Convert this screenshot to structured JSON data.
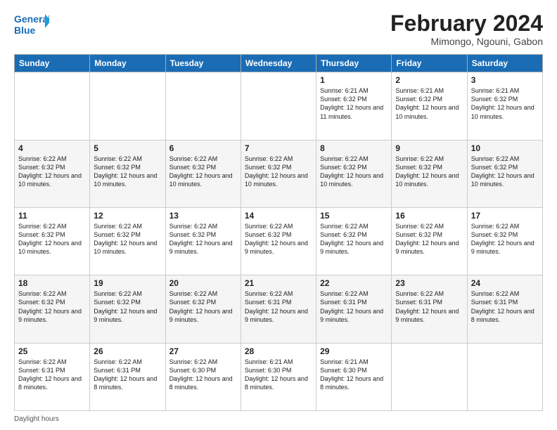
{
  "logo": {
    "line1": "General",
    "line2": "Blue"
  },
  "title": "February 2024",
  "subtitle": "Mimongo, Ngouni, Gabon",
  "days": [
    "Sunday",
    "Monday",
    "Tuesday",
    "Wednesday",
    "Thursday",
    "Friday",
    "Saturday"
  ],
  "weeks": [
    [
      {
        "num": "",
        "info": ""
      },
      {
        "num": "",
        "info": ""
      },
      {
        "num": "",
        "info": ""
      },
      {
        "num": "",
        "info": ""
      },
      {
        "num": "1",
        "info": "Sunrise: 6:21 AM\nSunset: 6:32 PM\nDaylight: 12 hours and 11 minutes."
      },
      {
        "num": "2",
        "info": "Sunrise: 6:21 AM\nSunset: 6:32 PM\nDaylight: 12 hours and 10 minutes."
      },
      {
        "num": "3",
        "info": "Sunrise: 6:21 AM\nSunset: 6:32 PM\nDaylight: 12 hours and 10 minutes."
      }
    ],
    [
      {
        "num": "4",
        "info": "Sunrise: 6:22 AM\nSunset: 6:32 PM\nDaylight: 12 hours and 10 minutes."
      },
      {
        "num": "5",
        "info": "Sunrise: 6:22 AM\nSunset: 6:32 PM\nDaylight: 12 hours and 10 minutes."
      },
      {
        "num": "6",
        "info": "Sunrise: 6:22 AM\nSunset: 6:32 PM\nDaylight: 12 hours and 10 minutes."
      },
      {
        "num": "7",
        "info": "Sunrise: 6:22 AM\nSunset: 6:32 PM\nDaylight: 12 hours and 10 minutes."
      },
      {
        "num": "8",
        "info": "Sunrise: 6:22 AM\nSunset: 6:32 PM\nDaylight: 12 hours and 10 minutes."
      },
      {
        "num": "9",
        "info": "Sunrise: 6:22 AM\nSunset: 6:32 PM\nDaylight: 12 hours and 10 minutes."
      },
      {
        "num": "10",
        "info": "Sunrise: 6:22 AM\nSunset: 6:32 PM\nDaylight: 12 hours and 10 minutes."
      }
    ],
    [
      {
        "num": "11",
        "info": "Sunrise: 6:22 AM\nSunset: 6:32 PM\nDaylight: 12 hours and 10 minutes."
      },
      {
        "num": "12",
        "info": "Sunrise: 6:22 AM\nSunset: 6:32 PM\nDaylight: 12 hours and 10 minutes."
      },
      {
        "num": "13",
        "info": "Sunrise: 6:22 AM\nSunset: 6:32 PM\nDaylight: 12 hours and 9 minutes."
      },
      {
        "num": "14",
        "info": "Sunrise: 6:22 AM\nSunset: 6:32 PM\nDaylight: 12 hours and 9 minutes."
      },
      {
        "num": "15",
        "info": "Sunrise: 6:22 AM\nSunset: 6:32 PM\nDaylight: 12 hours and 9 minutes."
      },
      {
        "num": "16",
        "info": "Sunrise: 6:22 AM\nSunset: 6:32 PM\nDaylight: 12 hours and 9 minutes."
      },
      {
        "num": "17",
        "info": "Sunrise: 6:22 AM\nSunset: 6:32 PM\nDaylight: 12 hours and 9 minutes."
      }
    ],
    [
      {
        "num": "18",
        "info": "Sunrise: 6:22 AM\nSunset: 6:32 PM\nDaylight: 12 hours and 9 minutes."
      },
      {
        "num": "19",
        "info": "Sunrise: 6:22 AM\nSunset: 6:32 PM\nDaylight: 12 hours and 9 minutes."
      },
      {
        "num": "20",
        "info": "Sunrise: 6:22 AM\nSunset: 6:32 PM\nDaylight: 12 hours and 9 minutes."
      },
      {
        "num": "21",
        "info": "Sunrise: 6:22 AM\nSunset: 6:31 PM\nDaylight: 12 hours and 9 minutes."
      },
      {
        "num": "22",
        "info": "Sunrise: 6:22 AM\nSunset: 6:31 PM\nDaylight: 12 hours and 9 minutes."
      },
      {
        "num": "23",
        "info": "Sunrise: 6:22 AM\nSunset: 6:31 PM\nDaylight: 12 hours and 9 minutes."
      },
      {
        "num": "24",
        "info": "Sunrise: 6:22 AM\nSunset: 6:31 PM\nDaylight: 12 hours and 8 minutes."
      }
    ],
    [
      {
        "num": "25",
        "info": "Sunrise: 6:22 AM\nSunset: 6:31 PM\nDaylight: 12 hours and 8 minutes."
      },
      {
        "num": "26",
        "info": "Sunrise: 6:22 AM\nSunset: 6:31 PM\nDaylight: 12 hours and 8 minutes."
      },
      {
        "num": "27",
        "info": "Sunrise: 6:22 AM\nSunset: 6:30 PM\nDaylight: 12 hours and 8 minutes."
      },
      {
        "num": "28",
        "info": "Sunrise: 6:21 AM\nSunset: 6:30 PM\nDaylight: 12 hours and 8 minutes."
      },
      {
        "num": "29",
        "info": "Sunrise: 6:21 AM\nSunset: 6:30 PM\nDaylight: 12 hours and 8 minutes."
      },
      {
        "num": "",
        "info": ""
      },
      {
        "num": "",
        "info": ""
      }
    ]
  ],
  "footer": "Daylight hours"
}
